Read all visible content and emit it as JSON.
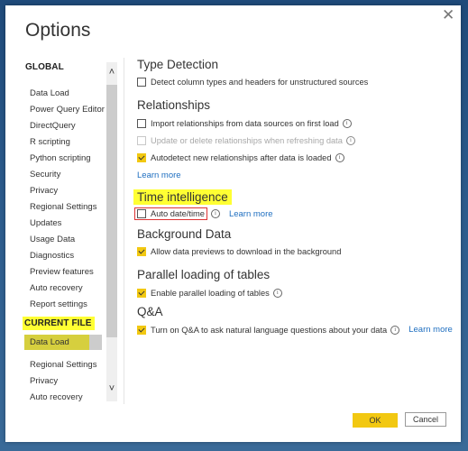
{
  "dialog": {
    "title": "Options",
    "close_icon": "close-icon"
  },
  "nav": {
    "global_header": "GLOBAL",
    "global_items": [
      {
        "label": "Data Load"
      },
      {
        "label": "Power Query Editor"
      },
      {
        "label": "DirectQuery"
      },
      {
        "label": "R scripting"
      },
      {
        "label": "Python scripting"
      },
      {
        "label": "Security"
      },
      {
        "label": "Privacy"
      },
      {
        "label": "Regional Settings"
      },
      {
        "label": "Updates"
      },
      {
        "label": "Usage Data"
      },
      {
        "label": "Diagnostics"
      },
      {
        "label": "Preview features"
      },
      {
        "label": "Auto recovery"
      },
      {
        "label": "Report settings"
      }
    ],
    "current_file_header": "CURRENT FILE",
    "current_file_items": [
      {
        "label": "Data Load",
        "selected": true
      },
      {
        "label": "Regional Settings"
      },
      {
        "label": "Privacy"
      },
      {
        "label": "Auto recovery"
      }
    ],
    "scroll_up_icon": "^",
    "scroll_down_icon": "v"
  },
  "content": {
    "type_detection": {
      "title": "Type Detection",
      "options": [
        {
          "label": "Detect column types and headers for unstructured sources",
          "checked": false
        }
      ]
    },
    "relationships": {
      "title": "Relationships",
      "options": [
        {
          "label": "Import relationships from data sources on first load",
          "checked": false,
          "info": true
        },
        {
          "label": "Update or delete relationships when refreshing data",
          "checked": false,
          "disabled": true,
          "info": true
        },
        {
          "label": "Autodetect new relationships after data is loaded",
          "checked": true,
          "info": true
        }
      ],
      "learn_more": "Learn more"
    },
    "time_intelligence": {
      "title": "Time intelligence",
      "options": [
        {
          "label": "Auto date/time",
          "checked": false,
          "info": true
        }
      ],
      "learn_more": "Learn more"
    },
    "background_data": {
      "title": "Background Data",
      "options": [
        {
          "label": "Allow data previews to download in the background",
          "checked": true
        }
      ]
    },
    "parallel_loading": {
      "title": "Parallel loading of tables",
      "options": [
        {
          "label": "Enable parallel loading of tables",
          "checked": true,
          "info": true
        }
      ]
    },
    "qna": {
      "title": "Q&A",
      "options": [
        {
          "label": "Turn on Q&A to ask natural language questions about your data",
          "checked": true,
          "info": true
        }
      ],
      "learn_more": "Learn more"
    }
  },
  "footer": {
    "ok_label": "OK",
    "cancel_label": "Cancel"
  },
  "colors": {
    "accent_yellow": "#f2c811",
    "highlight_yellow": "#ffff33",
    "link_blue": "#1f6fc0",
    "annotation_red": "#dd3333"
  }
}
